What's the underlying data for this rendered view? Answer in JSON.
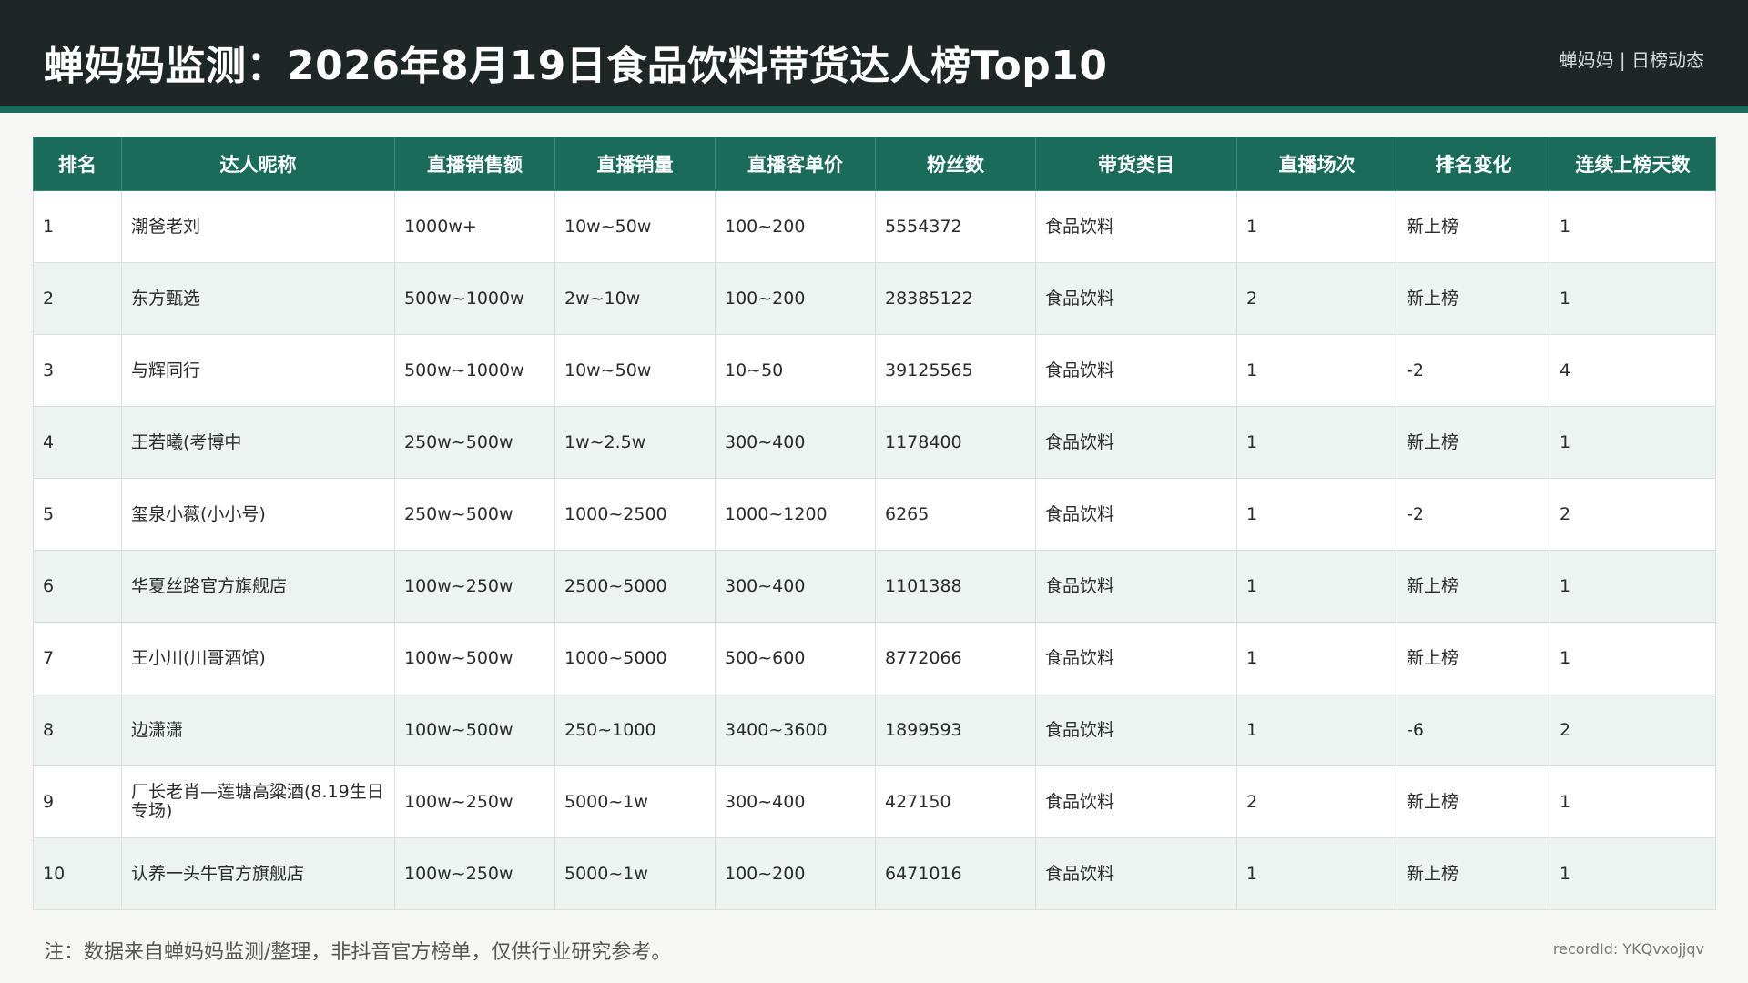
{
  "header": {
    "title": "蝉妈妈监测：2026年8月19日食品饮料带货达人榜Top10",
    "brand": "蝉妈妈 | 日榜动态"
  },
  "table": {
    "columns": [
      "排名",
      "达人昵称",
      "直播销售额",
      "直播销量",
      "直播客单价",
      "粉丝数",
      "带货类目",
      "直播场次",
      "排名变化",
      "连续上榜天数"
    ],
    "rows": [
      [
        "1",
        "潮爸老刘",
        "1000w+",
        "10w~50w",
        "100~200",
        "5554372",
        "食品饮料",
        "1",
        "新上榜",
        "1"
      ],
      [
        "2",
        "东方甄选",
        "500w~1000w",
        "2w~10w",
        "100~200",
        "28385122",
        "食品饮料",
        "2",
        "新上榜",
        "1"
      ],
      [
        "3",
        "与辉同行",
        "500w~1000w",
        "10w~50w",
        "10~50",
        "39125565",
        "食品饮料",
        "1",
        "-2",
        "4"
      ],
      [
        "4",
        "王若曦(考博中",
        "250w~500w",
        "1w~2.5w",
        "300~400",
        "1178400",
        "食品饮料",
        "1",
        "新上榜",
        "1"
      ],
      [
        "5",
        "玺泉小薇(小小号)",
        "250w~500w",
        "1000~2500",
        "1000~1200",
        "6265",
        "食品饮料",
        "1",
        "-2",
        "2"
      ],
      [
        "6",
        "华夏丝路官方旗舰店",
        "100w~250w",
        "2500~5000",
        "300~400",
        "1101388",
        "食品饮料",
        "1",
        "新上榜",
        "1"
      ],
      [
        "7",
        "王小川(川哥酒馆)",
        "100w~500w",
        "1000~5000",
        "500~600",
        "8772066",
        "食品饮料",
        "1",
        "新上榜",
        "1"
      ],
      [
        "8",
        "边潇潇",
        "100w~500w",
        "250~1000",
        "3400~3600",
        "1899593",
        "食品饮料",
        "1",
        "-6",
        "2"
      ],
      [
        "9",
        "厂长老肖—莲塘高粱酒(8.19生日专场)",
        "100w~250w",
        "5000~1w",
        "300~400",
        "427150",
        "食品饮料",
        "2",
        "新上榜",
        "1"
      ],
      [
        "10",
        "认养一头牛官方旗舰店",
        "100w~250w",
        "5000~1w",
        "100~200",
        "6471016",
        "食品饮料",
        "1",
        "新上榜",
        "1"
      ]
    ]
  },
  "footer": {
    "note": "注：数据来自蝉妈妈监测/整理，非抖音官方榜单，仅供行业研究参考。",
    "record_id": "recordId: YKQvxojjqv"
  },
  "colors": {
    "header_bg": "#1f2726",
    "accent": "#1b6b5a",
    "row_alt": "#edf3f1"
  }
}
